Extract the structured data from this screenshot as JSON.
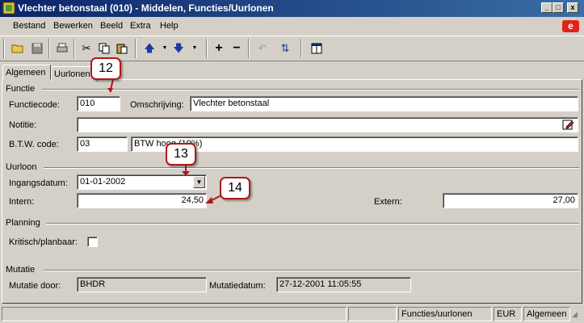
{
  "window": {
    "title": "Vlechter betonstaal (010) - Middelen, Functies/Uurlonen",
    "minimize": "_",
    "maximize": "□",
    "close": "x"
  },
  "menu": {
    "items": [
      "Bestand",
      "Bewerken",
      "Beeld",
      "Extra",
      "Help"
    ],
    "brand_letter": "e"
  },
  "tabs": [
    {
      "label": "Algemeen",
      "active": true
    },
    {
      "label": "Uurlonen",
      "active": false
    }
  ],
  "functie": {
    "header": "Functie",
    "code_label": "Functiecode:",
    "code_value": "010",
    "omschrijving_label": "Omschrijving:",
    "omschrijving_value": "Vlechter betonstaal",
    "notitie_label": "Notitie:",
    "notitie_value": "",
    "btw_label": "B.T.W. code:",
    "btw_code": "03",
    "btw_desc": "BTW hoog (19%)"
  },
  "uurloon": {
    "header": "Uurloon",
    "ingangsdatum_label": "Ingangsdatum:",
    "ingangsdatum_value": "01-01-2002",
    "intern_label": "Intern:",
    "intern_value": "24,50",
    "extern_label": "Extern:",
    "extern_value": "27,00"
  },
  "planning": {
    "header": "Planning",
    "kritisch_label": "Kritisch/planbaar:",
    "kritisch_checked": false
  },
  "mutatie": {
    "header": "Mutatie",
    "door_label": "Mutatie door:",
    "door_value": "BHDR",
    "datum_label": "Mutatiedatum:",
    "datum_value": "27-12-2001 11:05:55"
  },
  "callouts": [
    "12",
    "13",
    "14"
  ],
  "statusbar": {
    "module": "Functies/uurlonen",
    "currency": "EUR",
    "tab": "Algemeen"
  },
  "colors": {
    "titlebar_start": "#0a246a",
    "titlebar_end": "#3a6ea5",
    "callout_border": "#b01818",
    "brand": "#e2231a"
  }
}
